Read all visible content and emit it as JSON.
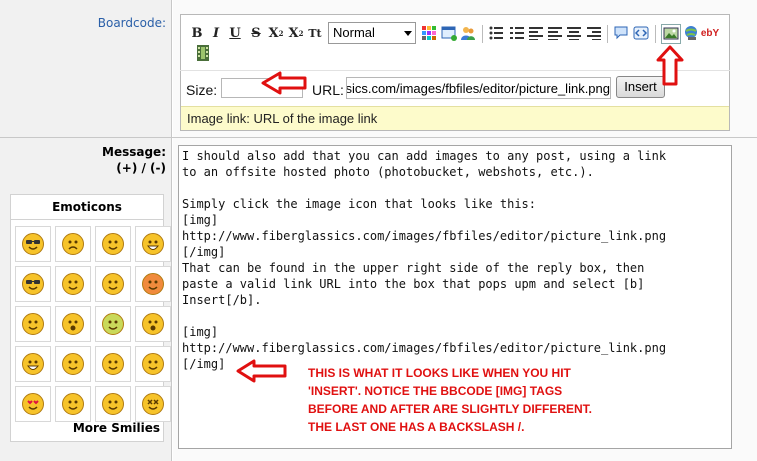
{
  "labels": {
    "boardcode": "Boardcode:",
    "message": "Message:",
    "message_sub": "(+) / (-)"
  },
  "toolbar": {
    "bold": "B",
    "italic": "I",
    "underline": "U",
    "strike": "S",
    "subscript": "X",
    "subscript_mark": "2",
    "superscript": "X",
    "superscript_mark": "2",
    "teletype": "Tt",
    "format_value": "Normal",
    "ebay_text": "ebY"
  },
  "insert": {
    "size_label": "Size:",
    "url_label": "URL:",
    "url_value": "http://www.fiberglassics.com/images/fbfiles/editor/picture_link.png",
    "button": "Insert",
    "hint": "Image link: URL of the image link"
  },
  "emoticons": {
    "title": "Emoticons",
    "more": "More Smilies",
    "faces": [
      {
        "name": "cool",
        "color": "#f6c32a"
      },
      {
        "name": "sad",
        "color": "#f6c32a"
      },
      {
        "name": "smile",
        "color": "#f6c32a"
      },
      {
        "name": "grin",
        "color": "#f6c32a"
      },
      {
        "name": "nerd",
        "color": "#f6c32a"
      },
      {
        "name": "wink",
        "color": "#f6c32a"
      },
      {
        "name": "tongue",
        "color": "#f6c32a"
      },
      {
        "name": "angry",
        "color": "#f08a3c"
      },
      {
        "name": "question",
        "color": "#f6c32a"
      },
      {
        "name": "shocked",
        "color": "#f6c32a"
      },
      {
        "name": "sick",
        "color": "#c9d95a"
      },
      {
        "name": "surprised",
        "color": "#f6c32a"
      },
      {
        "name": "laugh",
        "color": "#f6c32a"
      },
      {
        "name": "smirk",
        "color": "#f6c32a"
      },
      {
        "name": "happy",
        "color": "#f6c32a"
      },
      {
        "name": "blush",
        "color": "#f6c32a"
      },
      {
        "name": "love",
        "color": "#f6c32a"
      },
      {
        "name": "silly",
        "color": "#f6c32a"
      },
      {
        "name": "grimace",
        "color": "#f6c32a"
      },
      {
        "name": "dead",
        "color": "#f6c32a"
      }
    ]
  },
  "message_lines": [
    "I should also add that you can add images to any post, using a link",
    "to an offsite hosted photo (photobucket, webshots, etc.).",
    "",
    "Simply click the image icon that looks like this:",
    "[img]",
    "http://www.fiberglassics.com/images/fbfiles/editor/picture_link.png",
    "[/img]",
    "That can be found in the upper right side of the reply box, then",
    "paste a valid link URL into the box that pops upm and select [b]",
    "Insert[/b].",
    "",
    "[img]",
    "http://www.fiberglassics.com/images/fbfiles/editor/picture_link.png",
    "[/img]"
  ],
  "annotation_lines": [
    "THIS IS WHAT IT LOOKS LIKE WHEN YOU HIT",
    "'INSERT'.  NOTICE THE BBCODE [IMG] TAGS",
    "BEFORE AND AFTER ARE SLIGHTLY DIFFERENT.",
    "THE LAST ONE HAS A BACKSLASH /."
  ],
  "colors": {
    "annotation_red": "#e01010",
    "label_blue": "#2a5fa8",
    "hint_bg": "#fdfbcb"
  }
}
